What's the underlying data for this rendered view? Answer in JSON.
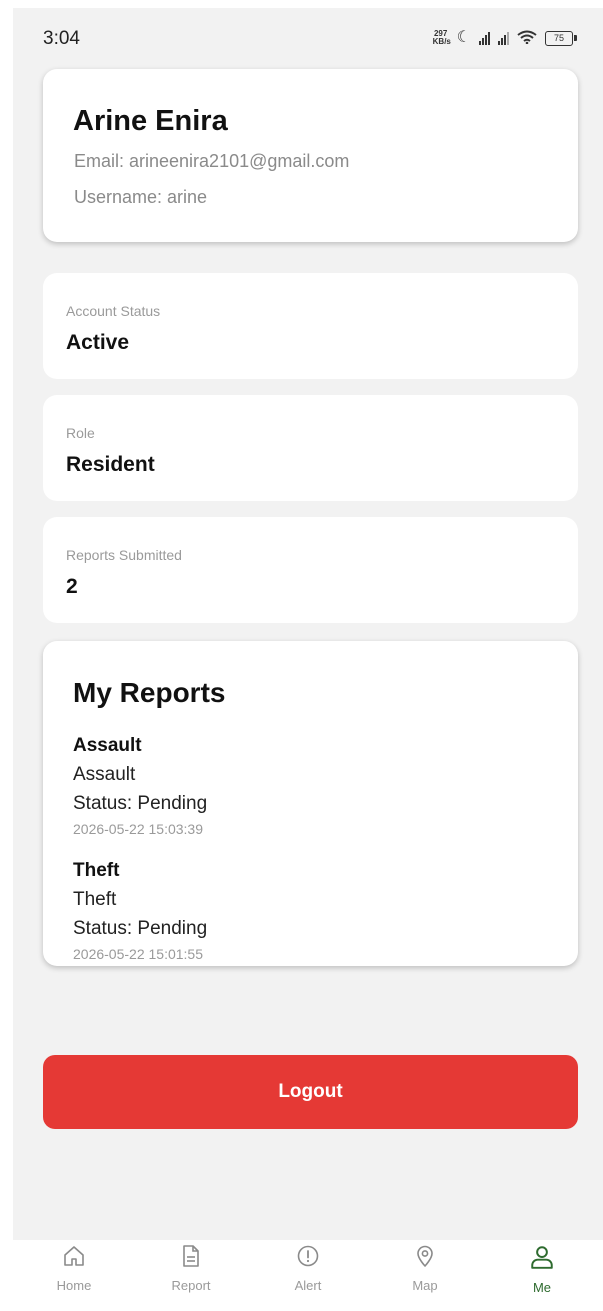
{
  "status_bar": {
    "time": "3:04",
    "net_speed": "297 KB/s",
    "battery": "75"
  },
  "profile": {
    "name": "Arine Enira",
    "email": "Email: arineenira2101@gmail.com",
    "username": "Username: arine"
  },
  "info_cards": [
    {
      "label": "Account Status",
      "value": "Active"
    },
    {
      "label": "Role",
      "value": "Resident"
    },
    {
      "label": "Reports Submitted",
      "value": "2"
    }
  ],
  "my_reports": {
    "title": "My Reports",
    "items": [
      {
        "title": "Assault",
        "type": "Assault",
        "status": "Status: Pending",
        "date": "2026-05-22 15:03:39"
      },
      {
        "title": "Theft",
        "type": "Theft",
        "status": "Status: Pending",
        "date": "2026-05-22 15:01:55"
      }
    ]
  },
  "logout_label": "Logout",
  "nav": {
    "active": "Me",
    "active_color": "#2e6b2f",
    "items": [
      {
        "label": "Home",
        "icon": "home-icon"
      },
      {
        "label": "Report",
        "icon": "document-icon"
      },
      {
        "label": "Alert",
        "icon": "alert-icon"
      },
      {
        "label": "Map",
        "icon": "map-pin-icon"
      },
      {
        "label": "Me",
        "icon": "user-icon"
      }
    ]
  },
  "colors": {
    "logout_button": "#e53935",
    "background": "#f2f2f2",
    "card": "#ffffff"
  }
}
